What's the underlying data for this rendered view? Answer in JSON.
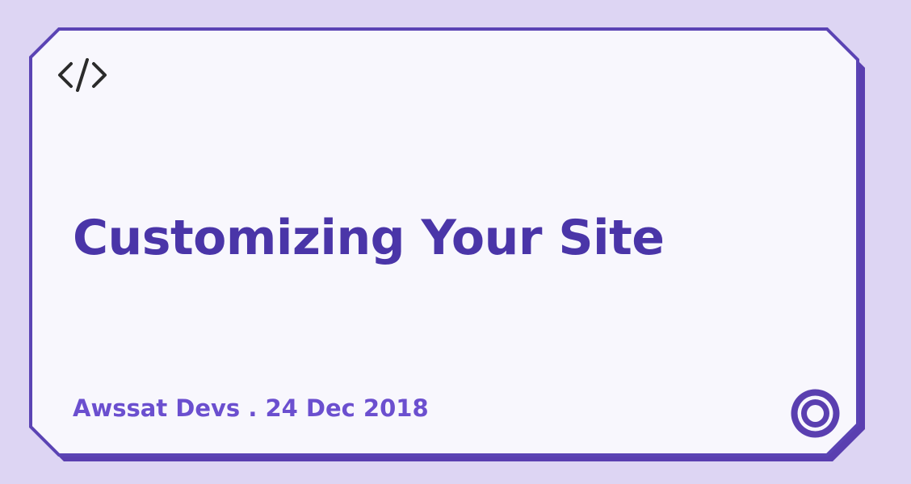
{
  "card": {
    "title": "Customizing Your Site",
    "author": "Awssat Devs",
    "separator": ".",
    "date": "24 Dec 2018"
  },
  "colors": {
    "background": "#ddd5f3",
    "card_fill": "#f8f7fd",
    "border": "#5b44b4",
    "shadow": "#5a3fb0",
    "title": "#4a35a8",
    "byline": "#6b4fcf",
    "code_icon": "#2b2b2b"
  },
  "icons": {
    "top_left": "code-icon",
    "bottom_right": "circle-logo-icon"
  }
}
